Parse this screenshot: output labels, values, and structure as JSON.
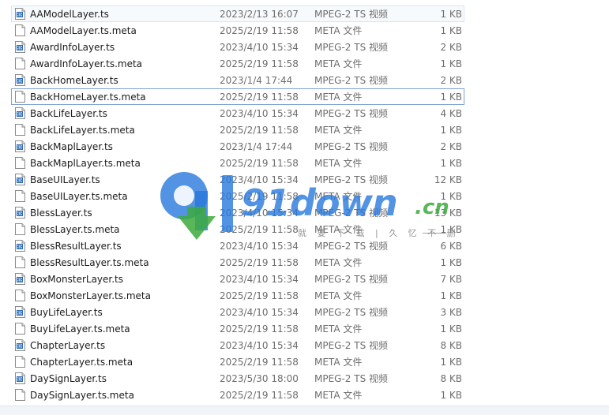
{
  "files": [
    {
      "name": "AAModelLayer.ts",
      "date": "2023/2/13 16:07",
      "type": "MPEG-2 TS 视频",
      "size": "1 KB",
      "icon": "ts-file-icon",
      "state": "hover"
    },
    {
      "name": "AAModelLayer.ts.meta",
      "date": "2025/2/19 11:58",
      "type": "META 文件",
      "size": "1 KB",
      "icon": "meta-file-icon",
      "state": ""
    },
    {
      "name": "AwardInfoLayer.ts",
      "date": "2023/4/10 15:34",
      "type": "MPEG-2 TS 视频",
      "size": "2 KB",
      "icon": "ts-file-icon",
      "state": ""
    },
    {
      "name": "AwardInfoLayer.ts.meta",
      "date": "2025/2/19 11:58",
      "type": "META 文件",
      "size": "1 KB",
      "icon": "meta-file-icon",
      "state": ""
    },
    {
      "name": "BackHomeLayer.ts",
      "date": "2023/1/4 17:44",
      "type": "MPEG-2 TS 视频",
      "size": "2 KB",
      "icon": "ts-file-icon",
      "state": ""
    },
    {
      "name": "BackHomeLayer.ts.meta",
      "date": "2025/2/19 11:58",
      "type": "META 文件",
      "size": "1 KB",
      "icon": "meta-file-icon",
      "state": "focus"
    },
    {
      "name": "BackLifeLayer.ts",
      "date": "2023/4/10 15:34",
      "type": "MPEG-2 TS 视频",
      "size": "4 KB",
      "icon": "ts-file-icon",
      "state": ""
    },
    {
      "name": "BackLifeLayer.ts.meta",
      "date": "2025/2/19 11:58",
      "type": "META 文件",
      "size": "1 KB",
      "icon": "meta-file-icon",
      "state": ""
    },
    {
      "name": "BackMaplLayer.ts",
      "date": "2023/1/4 17:44",
      "type": "MPEG-2 TS 视频",
      "size": "2 KB",
      "icon": "ts-file-icon",
      "state": ""
    },
    {
      "name": "BackMaplLayer.ts.meta",
      "date": "2025/2/19 11:58",
      "type": "META 文件",
      "size": "1 KB",
      "icon": "meta-file-icon",
      "state": ""
    },
    {
      "name": "BaseUILayer.ts",
      "date": "2023/4/10 15:34",
      "type": "MPEG-2 TS 视频",
      "size": "12 KB",
      "icon": "ts-file-icon",
      "state": ""
    },
    {
      "name": "BaseUILayer.ts.meta",
      "date": "2025/2/19 11:58",
      "type": "META 文件",
      "size": "1 KB",
      "icon": "meta-file-icon",
      "state": ""
    },
    {
      "name": "BlessLayer.ts",
      "date": "2023/4/10 15:34",
      "type": "MPEG-2 TS 视频",
      "size": "13 KB",
      "icon": "ts-file-icon",
      "state": ""
    },
    {
      "name": "BlessLayer.ts.meta",
      "date": "2025/2/19 11:58",
      "type": "META 文件",
      "size": "1 KB",
      "icon": "meta-file-icon",
      "state": ""
    },
    {
      "name": "BlessResultLayer.ts",
      "date": "2023/4/10 15:34",
      "type": "MPEG-2 TS 视频",
      "size": "6 KB",
      "icon": "ts-file-icon",
      "state": ""
    },
    {
      "name": "BlessResultLayer.ts.meta",
      "date": "2025/2/19 11:58",
      "type": "META 文件",
      "size": "1 KB",
      "icon": "meta-file-icon",
      "state": ""
    },
    {
      "name": "BoxMonsterLayer.ts",
      "date": "2023/4/10 15:34",
      "type": "MPEG-2 TS 视频",
      "size": "7 KB",
      "icon": "ts-file-icon",
      "state": ""
    },
    {
      "name": "BoxMonsterLayer.ts.meta",
      "date": "2025/2/19 11:58",
      "type": "META 文件",
      "size": "1 KB",
      "icon": "meta-file-icon",
      "state": ""
    },
    {
      "name": "BuyLifeLayer.ts",
      "date": "2023/4/10 15:34",
      "type": "MPEG-2 TS 视频",
      "size": "3 KB",
      "icon": "ts-file-icon",
      "state": ""
    },
    {
      "name": "BuyLifeLayer.ts.meta",
      "date": "2025/2/19 11:58",
      "type": "META 文件",
      "size": "1 KB",
      "icon": "meta-file-icon",
      "state": ""
    },
    {
      "name": "ChapterLayer.ts",
      "date": "2023/4/10 15:34",
      "type": "MPEG-2 TS 视频",
      "size": "8 KB",
      "icon": "ts-file-icon",
      "state": ""
    },
    {
      "name": "ChapterLayer.ts.meta",
      "date": "2025/2/19 11:58",
      "type": "META 文件",
      "size": "1 KB",
      "icon": "meta-file-icon",
      "state": ""
    },
    {
      "name": "DaySignLayer.ts",
      "date": "2023/5/30 18:00",
      "type": "MPEG-2 TS 视频",
      "size": "8 KB",
      "icon": "ts-file-icon",
      "state": ""
    },
    {
      "name": "DaySignLayer.ts.meta",
      "date": "2025/2/19 11:58",
      "type": "META 文件",
      "size": "1 KB",
      "icon": "meta-file-icon",
      "state": ""
    }
  ],
  "watermark": {
    "logo_text": "91down",
    "logo_suffix": ".cn",
    "slogan": "就 要 下 载 | 久 忆 不 删",
    "colors": {
      "blue": "#2878dc",
      "green": "#3caa3c"
    }
  }
}
